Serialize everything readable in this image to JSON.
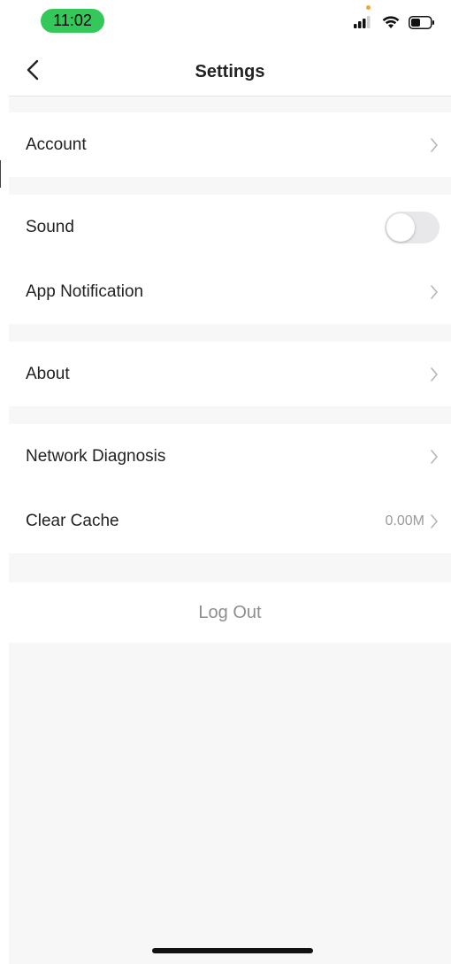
{
  "status_bar": {
    "time": "11:02",
    "icons": [
      "signal-icon",
      "wifi-icon",
      "battery-icon"
    ],
    "time_pill_color": "#34c85a"
  },
  "nav": {
    "title": "Settings",
    "back_icon": "chevron-left-icon"
  },
  "sections": {
    "account": {
      "label": "Account"
    },
    "sound": {
      "label": "Sound",
      "enabled": false
    },
    "app_notification": {
      "label": "App Notification"
    },
    "about": {
      "label": "About"
    },
    "network_diagnosis": {
      "label": "Network Diagnosis"
    },
    "clear_cache": {
      "label": "Clear Cache",
      "value": "0.00M"
    }
  },
  "logout": {
    "label": "Log Out"
  },
  "colors": {
    "background_gap": "#f7f7f7",
    "divider": "#e4e4e4",
    "muted_text": "#9a9a9a"
  }
}
